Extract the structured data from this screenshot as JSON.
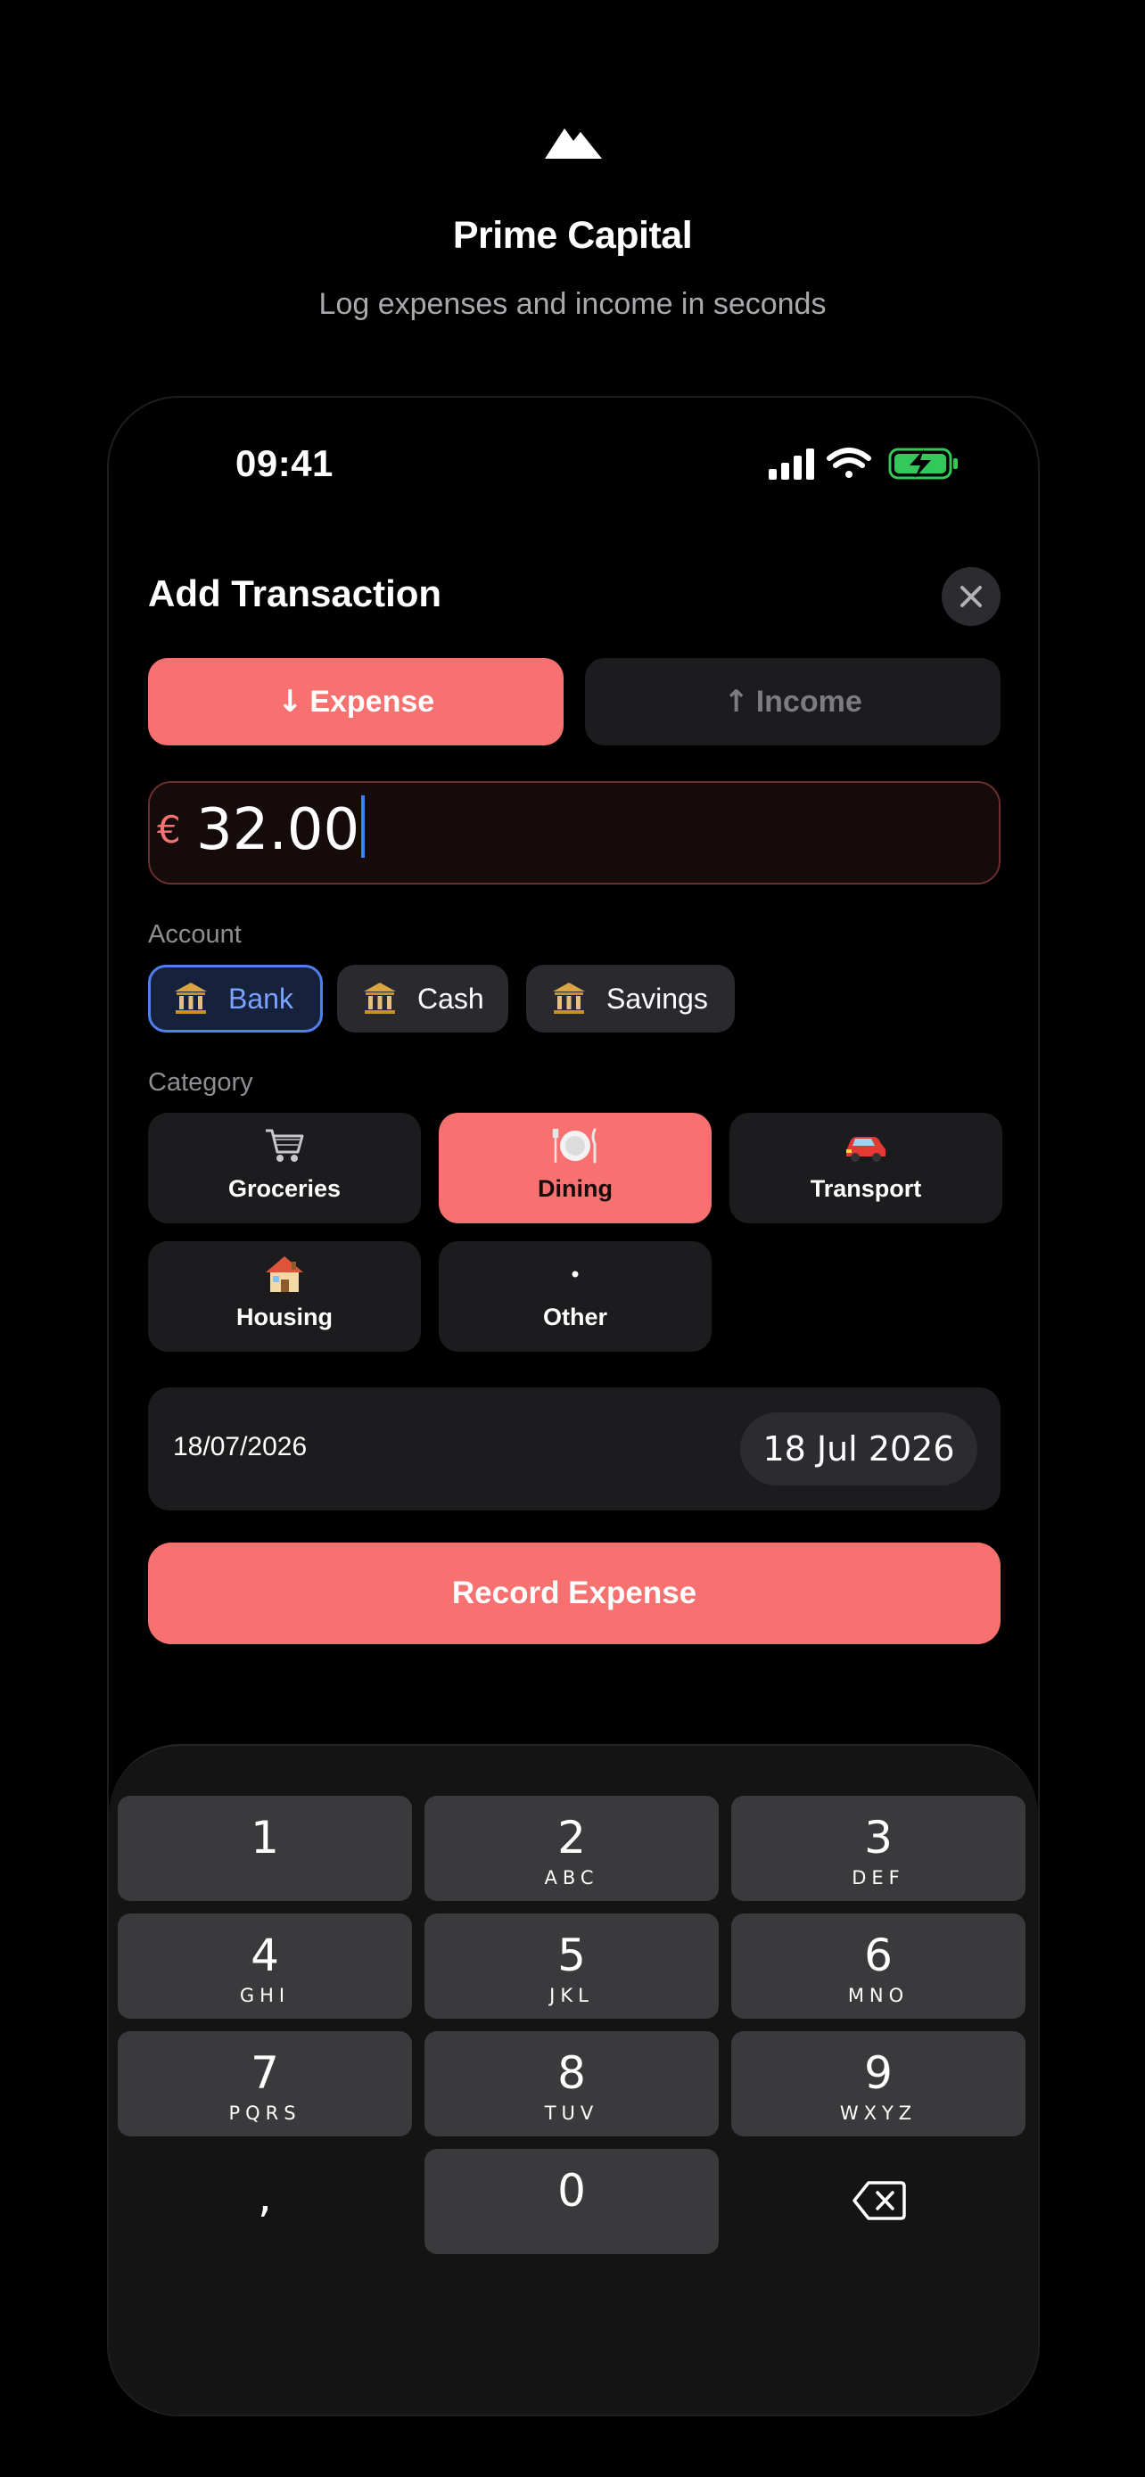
{
  "brand": {
    "name": "Prime Capital",
    "tagline": "Log expenses and income in seconds",
    "logo_icon": "mountain-logo-icon"
  },
  "status_bar": {
    "time": "09:41",
    "icons": [
      "cellular-signal-icon",
      "wifi-icon",
      "battery-charging-icon"
    ]
  },
  "sheet": {
    "title": "Add Transaction",
    "close_icon": "close-icon"
  },
  "type_toggle": {
    "expense_label": "Expense",
    "income_label": "Income",
    "selected": "expense"
  },
  "amount": {
    "currency": "€",
    "value": "32.00"
  },
  "account": {
    "label": "Account",
    "options": [
      {
        "label": "Bank",
        "icon": "bank-icon",
        "selected": true
      },
      {
        "label": "Cash",
        "icon": "bank-icon",
        "selected": false
      },
      {
        "label": "Savings",
        "icon": "bank-icon",
        "selected": false
      }
    ]
  },
  "category": {
    "label": "Category",
    "options": [
      {
        "label": "Groceries",
        "icon": "shopping-cart-icon",
        "selected": false
      },
      {
        "label": "Dining",
        "icon": "plate-cutlery-icon",
        "selected": true
      },
      {
        "label": "Transport",
        "icon": "car-icon",
        "selected": false
      },
      {
        "label": "Housing",
        "icon": "house-icon",
        "selected": false
      },
      {
        "label": "Other",
        "icon": "dot-icon",
        "selected": false
      }
    ]
  },
  "date": {
    "value": "18/07/2026",
    "display": "18 Jul 2026"
  },
  "submit": {
    "label": "Record Expense"
  },
  "keypad": {
    "keys": [
      {
        "digit": "1",
        "letters": ""
      },
      {
        "digit": "2",
        "letters": "ABC"
      },
      {
        "digit": "3",
        "letters": "DEF"
      },
      {
        "digit": "4",
        "letters": "GHI"
      },
      {
        "digit": "5",
        "letters": "JKL"
      },
      {
        "digit": "6",
        "letters": "MNO"
      },
      {
        "digit": "7",
        "letters": "PQRS"
      },
      {
        "digit": "8",
        "letters": "TUV"
      },
      {
        "digit": "9",
        "letters": "WXYZ"
      },
      {
        "digit": ",",
        "letters": ""
      },
      {
        "digit": "0",
        "letters": ""
      },
      {
        "digit": "",
        "letters": ""
      }
    ],
    "backspace_icon": "backspace-icon"
  },
  "colors": {
    "accent": "#f87171",
    "selection_blue": "#4f7ff0",
    "surface": "#1c1c1e",
    "background": "#000000"
  }
}
